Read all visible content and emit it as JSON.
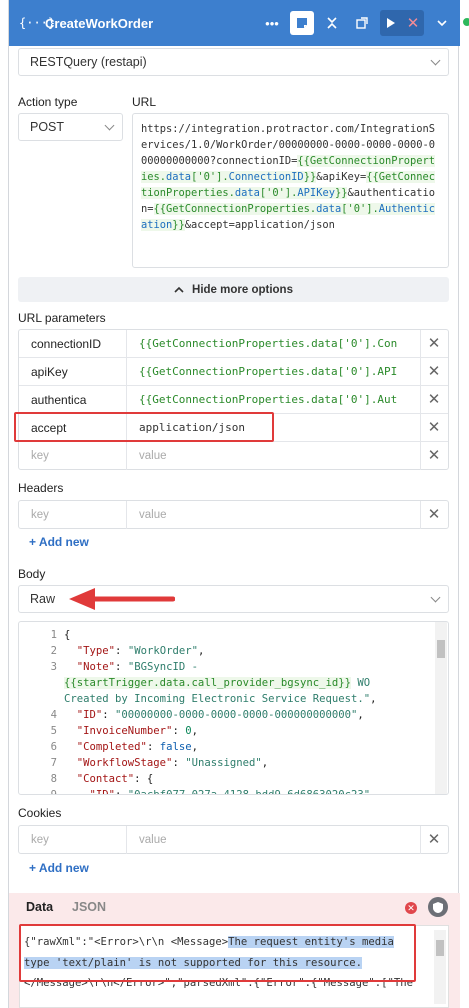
{
  "header": {
    "title": "CreateWorkOrder",
    "brace_icon": "{···}"
  },
  "resource": {
    "selected": "RESTQuery (restapi)"
  },
  "action_type": {
    "label": "Action type",
    "selected": "POST"
  },
  "url": {
    "label": "URL",
    "parts": [
      {
        "t": "https://integration.protractor.com/IntegrationServices/1.0/WorkOrder/00000000-0000-0000-0000-000000000000?connectionID=",
        "k": "plain"
      },
      {
        "t": "{{GetConnectionProperties.",
        "k": "tmpl"
      },
      {
        "t": "data",
        "k": "tmplb"
      },
      {
        "t": "['0'].",
        "k": "tmpl"
      },
      {
        "t": "ConnectionID",
        "k": "tmplb"
      },
      {
        "t": "}}",
        "k": "tmpl"
      },
      {
        "t": "&apiKey=",
        "k": "plain"
      },
      {
        "t": "{{GetConnectionProperties.",
        "k": "tmpl"
      },
      {
        "t": "data",
        "k": "tmplb"
      },
      {
        "t": "['0'].",
        "k": "tmpl"
      },
      {
        "t": "APIKey",
        "k": "tmplb"
      },
      {
        "t": "}}",
        "k": "tmpl"
      },
      {
        "t": "&authentication=",
        "k": "plain"
      },
      {
        "t": "{{GetConnectionProperties.",
        "k": "tmpl"
      },
      {
        "t": "data",
        "k": "tmplb"
      },
      {
        "t": "['0'].",
        "k": "tmpl"
      },
      {
        "t": "Authentication",
        "k": "tmplb"
      },
      {
        "t": "}}",
        "k": "tmpl"
      },
      {
        "t": "&accept=application/json",
        "k": "plain"
      }
    ]
  },
  "hide_options": {
    "label": "Hide more options",
    "icon": "chevron-up-icon"
  },
  "url_params": {
    "label": "URL parameters",
    "rows": [
      {
        "key": "connectionID",
        "value": "{{GetConnectionProperties.data['0'].Con",
        "tmpl": true
      },
      {
        "key": "apiKey",
        "value": "{{GetConnectionProperties.data['0'].API",
        "tmpl": true
      },
      {
        "key": "authentica",
        "value": "{{GetConnectionProperties.data['0'].Aut",
        "tmpl": true
      },
      {
        "key": "accept",
        "value": "application/json",
        "tmpl": false
      }
    ],
    "key_placeholder": "key",
    "value_placeholder": "value"
  },
  "headers": {
    "label": "Headers",
    "key_placeholder": "key",
    "value_placeholder": "value",
    "add_new": "+ Add new"
  },
  "body": {
    "label": "Body",
    "type": "Raw",
    "lines": [
      {
        "n": "1",
        "html": "{"
      },
      {
        "n": "2",
        "html": "  <span class='key'>\"Type\"</span>: <span class='str'>\"WorkOrder\"</span>,"
      },
      {
        "n": "3",
        "html": "  <span class='key'>\"Note\"</span>: <span class='str'>\"BGSyncID -</span>"
      },
      {
        "n": "",
        "html": "<span class='tmpl'>{{startTrigger.data.call_provider_bgsync_id}}</span><span class='str'> WO</span>"
      },
      {
        "n": "",
        "html": "<span class='str'>Created by Incoming Electronic Service Request.\"</span>,"
      },
      {
        "n": "4",
        "html": "  <span class='key'>\"ID\"</span>: <span class='str'>\"00000000-0000-0000-0000-000000000000\"</span>,"
      },
      {
        "n": "5",
        "html": "  <span class='key'>\"InvoiceNumber\"</span>: <span class='num'>0</span>,"
      },
      {
        "n": "6",
        "html": "  <span class='key'>\"Completed\"</span>: <span class='kw'>false</span>,"
      },
      {
        "n": "7",
        "html": "  <span class='key'>\"WorkflowStage\"</span>: <span class='str'>\"Unassigned\"</span>,"
      },
      {
        "n": "8",
        "html": "  <span class='key'>\"Contact\"</span>: {"
      },
      {
        "n": "9",
        "html": "    <span class='key'>\"ID\"</span>: <span class='str'>\"0acbf077-027a-4128-bdd9-6d6863020c23\"</span>,"
      }
    ]
  },
  "cookies": {
    "label": "Cookies",
    "key_placeholder": "key",
    "value_placeholder": "value",
    "add_new": "+ Add new"
  },
  "result": {
    "tabs": [
      "Data",
      "JSON"
    ],
    "line1_pre": "{\"rawXml\":\"<Error>\\r\\n  <Message>",
    "line1_sel": "The request entity's media",
    "line2_sel": "type 'text/plain' is not supported for this resource.",
    "line3": "</Message>\\r\\n</Error>\",\"parsedXml\":{\"Error\":{\"Message\":[\"The"
  },
  "colors": {
    "header": "#3d7fce",
    "annotation": "#e03a3a",
    "template_text": "#2a8a2a",
    "error_bg": "#fbe9ea"
  }
}
